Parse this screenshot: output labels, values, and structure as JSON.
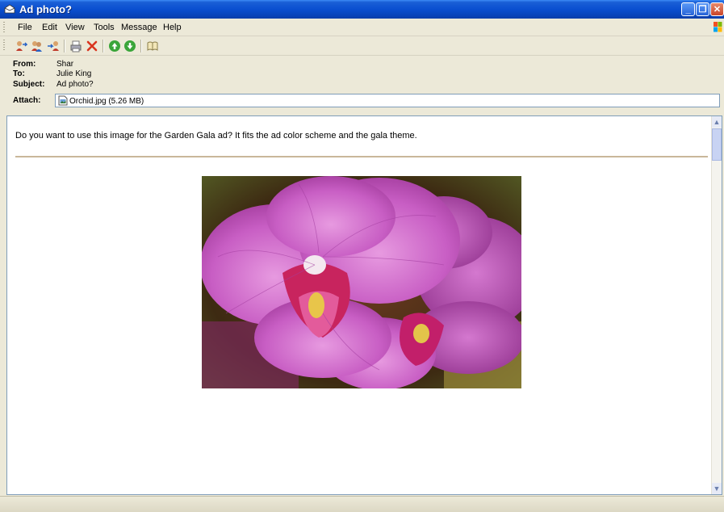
{
  "window": {
    "title": "Ad photo?",
    "controls": [
      "minimize-icon",
      "restore-icon",
      "close-icon"
    ]
  },
  "menu": [
    {
      "label": "File"
    },
    {
      "label": "Edit"
    },
    {
      "label": "View"
    },
    {
      "label": "Tools"
    },
    {
      "label": "Message"
    },
    {
      "label": "Help"
    }
  ],
  "toolbar": {
    "buttons": [
      "reply-icon",
      "reply-all-icon",
      "forward-icon",
      "print-icon",
      "delete-icon",
      "previous-icon",
      "next-icon",
      "addresses-icon"
    ]
  },
  "header": {
    "from_label": "From:",
    "from": "Shar",
    "to_label": "To:",
    "to": "Julie King",
    "subject_label": "Subject:",
    "subject": "Ad photo?",
    "attach_label": "Attach:",
    "attachment": "Orchid.jpg (5.26 MB)"
  },
  "message": {
    "body": "Do you want to use this image for the Garden Gala ad? It fits the ad color scheme and the gala theme."
  },
  "colors": {
    "titlebar": "#0a4fd0",
    "chrome": "#ece9d8",
    "divider": "#c9b79a"
  }
}
